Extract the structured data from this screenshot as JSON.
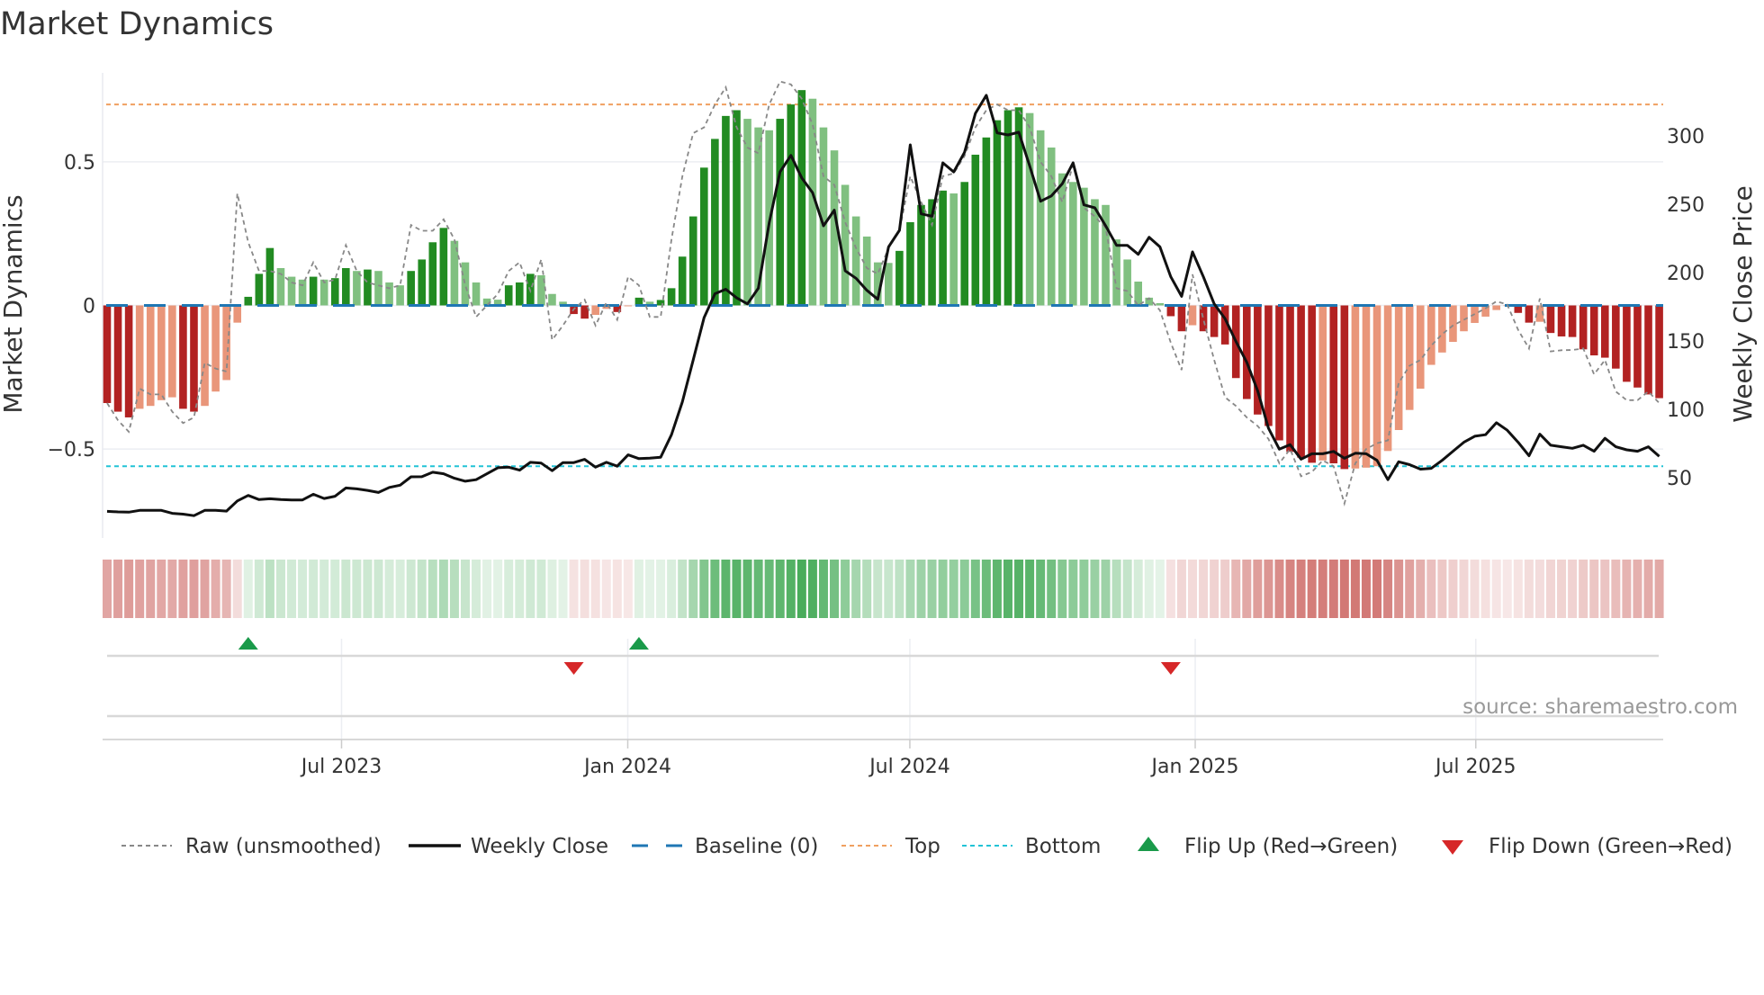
{
  "chart_data": {
    "type": "bar",
    "title": "Market Dynamics",
    "ylabel": "Market Dynamics",
    "ylabel_right": "Weekly Close Price",
    "ylim": [
      -0.81,
      0.81
    ],
    "ylim_right": [
      5.9,
      346
    ],
    "yticks": [
      {
        "v": 0.5,
        "label": "0.5"
      },
      {
        "v": 0,
        "label": "0"
      },
      {
        "v": -0.5,
        "label": "−0.5"
      }
    ],
    "yticks_right": [
      {
        "v": 300,
        "label": "300"
      },
      {
        "v": 250,
        "label": "250"
      },
      {
        "v": 200,
        "label": "200"
      },
      {
        "v": 150,
        "label": "150"
      },
      {
        "v": 100,
        "label": "100"
      },
      {
        "v": 50,
        "label": "50"
      }
    ],
    "xticks": [
      {
        "week": 21.6,
        "label": "Jul 2023"
      },
      {
        "week": 47.97,
        "label": "Jan 2024"
      },
      {
        "week": 73.96,
        "label": "Jul 2024"
      },
      {
        "week": 100.25,
        "label": "Jan 2025"
      },
      {
        "week": 126.1,
        "label": "Jul 2025"
      }
    ],
    "top_level": 0.7,
    "bottom_level": -0.56,
    "baseline": 0,
    "smoothed": [
      -0.34,
      -0.37,
      -0.39,
      -0.36,
      -0.35,
      -0.33,
      -0.32,
      -0.36,
      -0.37,
      -0.35,
      -0.3,
      -0.26,
      -0.06,
      0.03,
      0.11,
      0.2,
      0.13,
      0.1,
      0.09,
      0.1,
      0.09,
      0.095,
      0.13,
      0.12,
      0.125,
      0.12,
      0.08,
      0.07,
      0.12,
      0.16,
      0.22,
      0.27,
      0.225,
      0.15,
      0.08,
      0.024,
      0.02,
      0.07,
      0.08,
      0.11,
      0.105,
      0.04,
      0.013,
      -0.03,
      -0.046,
      -0.033,
      -0.012,
      -0.023,
      -0.003,
      0.027,
      0.013,
      0.019,
      0.06,
      0.17,
      0.31,
      0.48,
      0.58,
      0.66,
      0.68,
      0.65,
      0.62,
      0.61,
      0.65,
      0.7,
      0.75,
      0.72,
      0.62,
      0.54,
      0.42,
      0.31,
      0.24,
      0.15,
      0.148,
      0.19,
      0.29,
      0.35,
      0.37,
      0.4,
      0.39,
      0.43,
      0.525,
      0.585,
      0.645,
      0.68,
      0.69,
      0.67,
      0.61,
      0.55,
      0.46,
      0.43,
      0.41,
      0.37,
      0.35,
      0.23,
      0.16,
      0.083,
      0.027,
      0.008,
      -0.0375,
      -0.09,
      -0.069,
      -0.09,
      -0.11,
      -0.136,
      -0.253,
      -0.326,
      -0.38,
      -0.42,
      -0.47,
      -0.51,
      -0.53,
      -0.548,
      -0.54,
      -0.55,
      -0.57,
      -0.568,
      -0.565,
      -0.56,
      -0.507,
      -0.434,
      -0.364,
      -0.29,
      -0.207,
      -0.164,
      -0.127,
      -0.09,
      -0.061,
      -0.039,
      -0.016,
      -0.002,
      -0.026,
      -0.06,
      -0.057,
      -0.096,
      -0.108,
      -0.11,
      -0.153,
      -0.174,
      -0.182,
      -0.22,
      -0.266,
      -0.286,
      -0.31,
      -0.323
    ],
    "raw": [
      -0.34,
      -0.4,
      -0.44,
      -0.29,
      -0.31,
      -0.31,
      -0.37,
      -0.41,
      -0.39,
      -0.2,
      -0.22,
      -0.23,
      0.39,
      0.22,
      0.12,
      0.12,
      0.11,
      0.08,
      0.07,
      0.15,
      0.08,
      0.09,
      0.21,
      0.12,
      0.08,
      0.07,
      0.06,
      0.07,
      0.28,
      0.26,
      0.26,
      0.3,
      0.23,
      0.07,
      -0.04,
      0.0,
      0.04,
      0.12,
      0.15,
      0.05,
      0.16,
      -0.12,
      -0.07,
      -0.013,
      0.02,
      -0.07,
      0.01,
      -0.05,
      0.1,
      0.07,
      -0.04,
      -0.04,
      0.23,
      0.45,
      0.6,
      0.62,
      0.7,
      0.76,
      0.62,
      0.55,
      0.53,
      0.7,
      0.78,
      0.77,
      0.72,
      0.63,
      0.45,
      0.42,
      0.29,
      0.2,
      0.13,
      0.11,
      0.2,
      0.26,
      0.45,
      0.36,
      0.28,
      0.45,
      0.46,
      0.52,
      0.62,
      0.68,
      0.7,
      0.68,
      0.68,
      0.62,
      0.5,
      0.45,
      0.36,
      0.49,
      0.34,
      0.31,
      0.27,
      0.06,
      0.05,
      0.0,
      0.025,
      -0.017,
      -0.13,
      -0.225,
      0.108,
      -0.048,
      -0.19,
      -0.32,
      -0.35,
      -0.39,
      -0.42,
      -0.465,
      -0.55,
      -0.5,
      -0.595,
      -0.58,
      -0.54,
      -0.56,
      -0.69,
      -0.55,
      -0.5,
      -0.48,
      -0.47,
      -0.27,
      -0.21,
      -0.19,
      -0.14,
      -0.1,
      -0.07,
      -0.05,
      -0.03,
      -0.01,
      0.014,
      0.003,
      -0.085,
      -0.15,
      0.024,
      -0.16,
      -0.156,
      -0.155,
      -0.15,
      -0.24,
      -0.19,
      -0.3,
      -0.33,
      -0.33,
      -0.3,
      -0.34
    ],
    "close": [
      25.4,
      25,
      24.8,
      26.1,
      26.1,
      26.1,
      23.9,
      23.3,
      22.2,
      26.1,
      26.1,
      25.6,
      33,
      37,
      34,
      34.6,
      34,
      33.7,
      33.7,
      37.9,
      34.8,
      36.4,
      42.5,
      41.8,
      40.7,
      39.2,
      42.9,
      44.5,
      50.6,
      50.7,
      54,
      52.9,
      49.6,
      47.4,
      48.5,
      52.9,
      57.3,
      57.7,
      55.5,
      61.2,
      60.6,
      55.1,
      61,
      61,
      63.4,
      57.7,
      61.2,
      58.4,
      66.7,
      63.9,
      64.3,
      65,
      81.4,
      105.5,
      136,
      167,
      184.5,
      187.8,
      181.5,
      177.1,
      188.5,
      236.4,
      273.6,
      285.7,
      269.2,
      258.3,
      234.2,
      245.6,
      201.3,
      195.8,
      187,
      180.4,
      218.8,
      230.9,
      293.4,
      242.9,
      241.2,
      280.2,
      273.6,
      287.9,
      316.4,
      329.6,
      302.1,
      300.6,
      302.6,
      278,
      252.1,
      256,
      264.9,
      280.2,
      249.5,
      247.3,
      234.2,
      219.9,
      219.9,
      213.3,
      225.8,
      218.8,
      196.9,
      182.6,
      215.1,
      196.9,
      177.1,
      166.2,
      149.7,
      134.4,
      113.5,
      86.2,
      70.8,
      74.1,
      63.5,
      67.5,
      67.5,
      69.2,
      64.2,
      67.9,
      67.5,
      62.7,
      48.5,
      61.6,
      59.5,
      56.2,
      56.8,
      62.7,
      69.3,
      75.9,
      80.3,
      81.4,
      90.2,
      84.7,
      75.9,
      66,
      81.8,
      73.7,
      72.6,
      71.5,
      73.7,
      69.3,
      78.8,
      72.6,
      70.4,
      69.3,
      72.6,
      65.6
    ],
    "flip_up_weeks": [
      13,
      49
    ],
    "flip_down_weeks": [
      43,
      98
    ],
    "legend": {
      "position": "bottom",
      "items": [
        {
          "key": "raw",
          "label": "Raw (unsmoothed)"
        },
        {
          "key": "close",
          "label": "Weekly Close"
        },
        {
          "key": "baseline",
          "label": "Baseline (0)"
        },
        {
          "key": "top",
          "label": "Top"
        },
        {
          "key": "bottom",
          "label": "Bottom"
        },
        {
          "key": "flipup",
          "label": "Flip Up (Red→Green)"
        },
        {
          "key": "flipdown",
          "label": "Flip Down (Green→Red)"
        }
      ]
    },
    "source": "source: sharemaestro.com",
    "colors": {
      "dark_green": "#228b22",
      "light_green": "#80c080",
      "dark_red": "#b22222",
      "light_red": "#e9967a",
      "baseline": "#1f77b4",
      "top": "#f0a060",
      "bottom": "#22c3d6",
      "raw": "#888888",
      "close": "#111111",
      "flip_up": "#1a9a4a",
      "flip_down": "#d62728",
      "strip_green": "#2ea043",
      "strip_red": "#be3c37"
    }
  }
}
